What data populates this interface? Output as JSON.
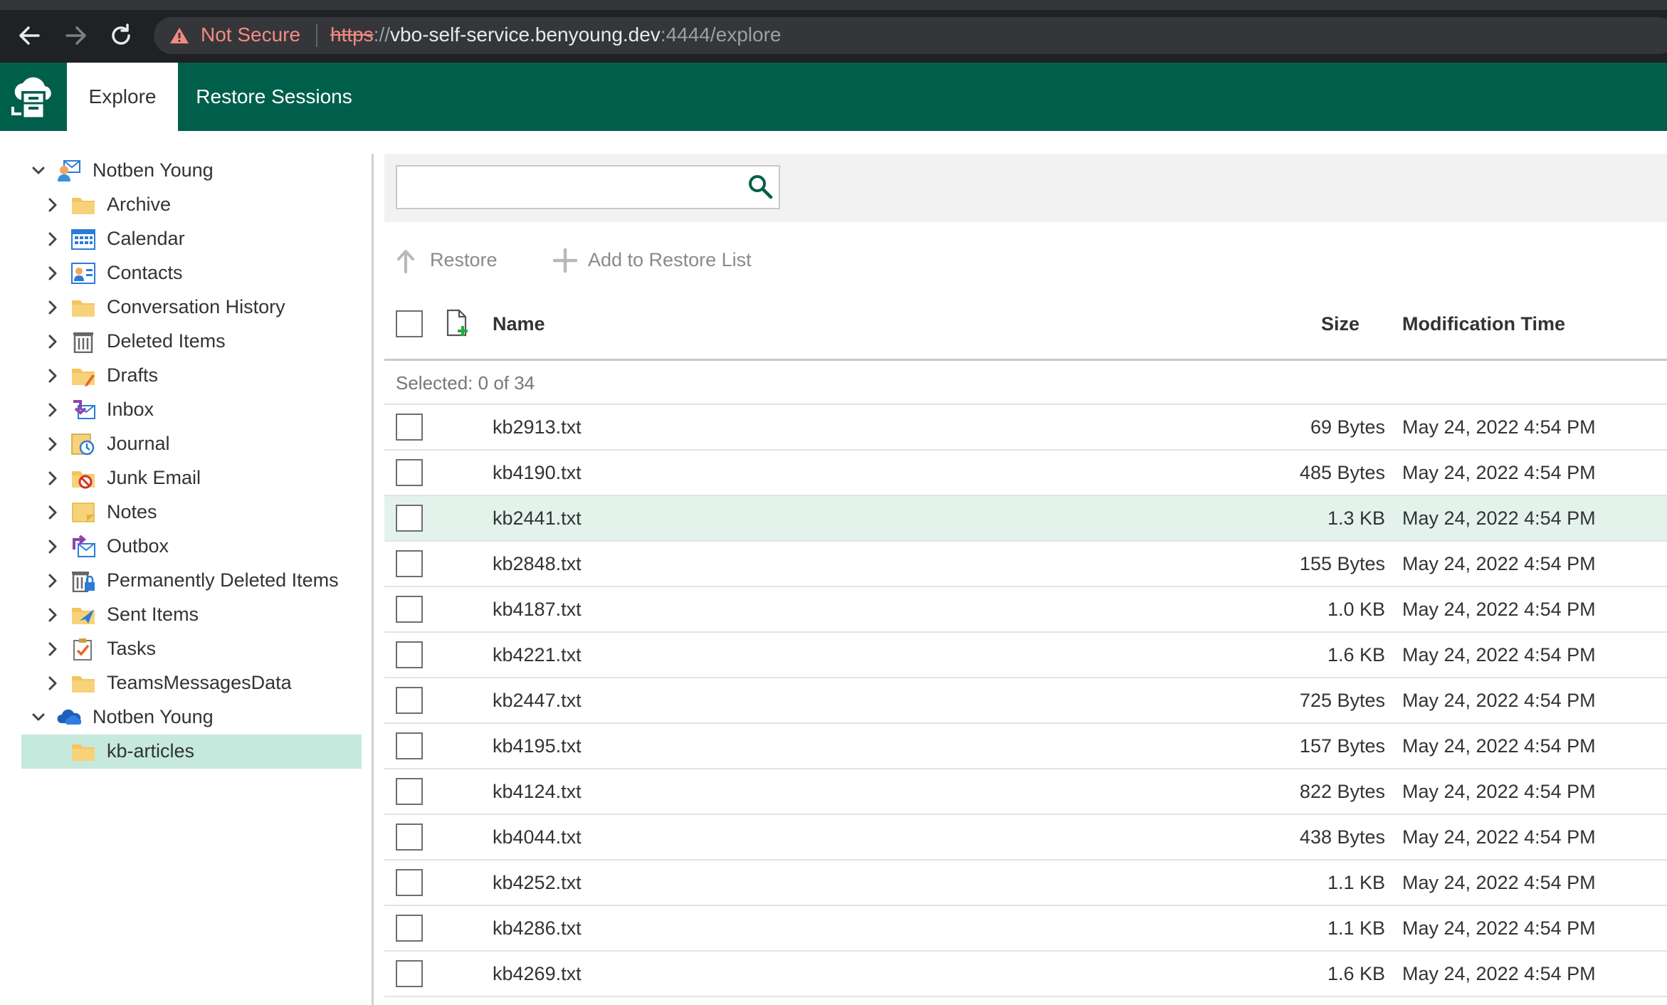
{
  "browser": {
    "security_label": "Not Secure",
    "url_scheme": "https",
    "url_separator": "://",
    "url_host": "vbo-self-service.benyoung.dev",
    "url_rest": ":4444/explore"
  },
  "app": {
    "tabs": [
      {
        "label": "Explore",
        "active": true
      },
      {
        "label": "Restore Sessions",
        "active": false
      }
    ],
    "accent_color": "#005f4b"
  },
  "tree": {
    "mailbox_root": {
      "label": "Notben Young",
      "expanded": true,
      "icon": "mailbox-user-icon"
    },
    "folders": [
      {
        "label": "Archive",
        "icon": "folder-icon"
      },
      {
        "label": "Calendar",
        "icon": "calendar-icon"
      },
      {
        "label": "Contacts",
        "icon": "contacts-icon"
      },
      {
        "label": "Conversation History",
        "icon": "folder-icon"
      },
      {
        "label": "Deleted Items",
        "icon": "trash-icon"
      },
      {
        "label": "Drafts",
        "icon": "drafts-icon"
      },
      {
        "label": "Inbox",
        "icon": "inbox-icon"
      },
      {
        "label": "Journal",
        "icon": "journal-icon"
      },
      {
        "label": "Junk Email",
        "icon": "junk-email-icon"
      },
      {
        "label": "Notes",
        "icon": "notes-icon"
      },
      {
        "label": "Outbox",
        "icon": "outbox-icon"
      },
      {
        "label": "Permanently Deleted Items",
        "icon": "locked-trash-icon"
      },
      {
        "label": "Sent Items",
        "icon": "sent-items-icon"
      },
      {
        "label": "Tasks",
        "icon": "tasks-icon"
      },
      {
        "label": "TeamsMessagesData",
        "icon": "folder-icon"
      }
    ],
    "onedrive_root": {
      "label": "Notben Young",
      "expanded": true,
      "icon": "onedrive-cloud-icon"
    },
    "onedrive_folders": [
      {
        "label": "kb-articles",
        "icon": "folder-icon",
        "selected": true
      }
    ]
  },
  "search": {
    "value": "",
    "placeholder": ""
  },
  "toolbar": {
    "restore_label": "Restore",
    "add_label": "Add to Restore List"
  },
  "grid": {
    "headers": {
      "name": "Name",
      "size": "Size",
      "time": "Modification Time"
    },
    "selected_text": "Selected: 0 of 34",
    "rows": [
      {
        "name": "kb2913.txt",
        "size": "69 Bytes",
        "time": "May 24, 2022 4:54 PM"
      },
      {
        "name": "kb4190.txt",
        "size": "485 Bytes",
        "time": "May 24, 2022 4:54 PM"
      },
      {
        "name": "kb2441.txt",
        "size": "1.3 KB",
        "time": "May 24, 2022 4:54 PM",
        "highlight": true
      },
      {
        "name": "kb2848.txt",
        "size": "155 Bytes",
        "time": "May 24, 2022 4:54 PM"
      },
      {
        "name": "kb4187.txt",
        "size": "1.0 KB",
        "time": "May 24, 2022 4:54 PM"
      },
      {
        "name": "kb4221.txt",
        "size": "1.6 KB",
        "time": "May 24, 2022 4:54 PM"
      },
      {
        "name": "kb2447.txt",
        "size": "725 Bytes",
        "time": "May 24, 2022 4:54 PM"
      },
      {
        "name": "kb4195.txt",
        "size": "157 Bytes",
        "time": "May 24, 2022 4:54 PM"
      },
      {
        "name": "kb4124.txt",
        "size": "822 Bytes",
        "time": "May 24, 2022 4:54 PM"
      },
      {
        "name": "kb4044.txt",
        "size": "438 Bytes",
        "time": "May 24, 2022 4:54 PM"
      },
      {
        "name": "kb4252.txt",
        "size": "1.1 KB",
        "time": "May 24, 2022 4:54 PM"
      },
      {
        "name": "kb4286.txt",
        "size": "1.1 KB",
        "time": "May 24, 2022 4:54 PM"
      },
      {
        "name": "kb4269.txt",
        "size": "1.6 KB",
        "time": "May 24, 2022 4:54 PM"
      }
    ]
  }
}
